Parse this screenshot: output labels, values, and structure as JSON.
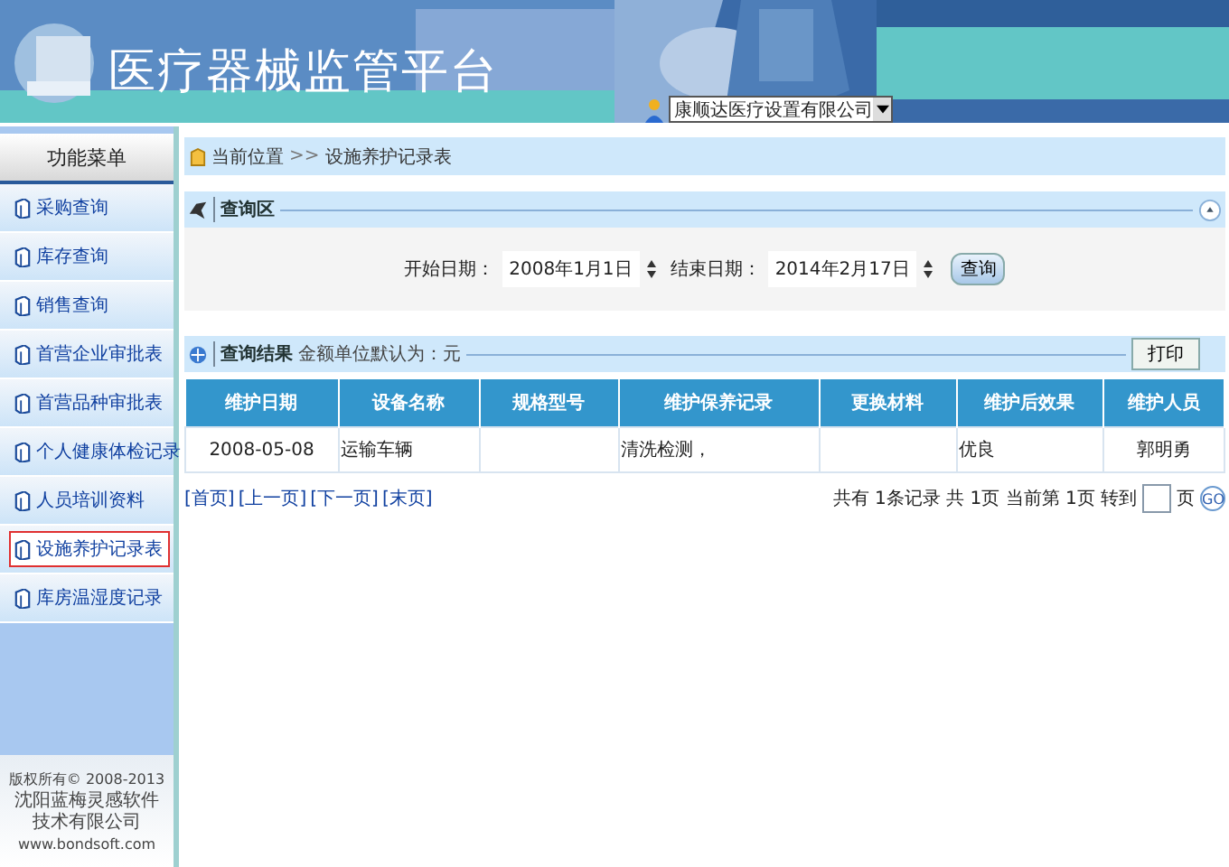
{
  "header": {
    "title": "医疗器械监管平台",
    "company_select": {
      "value": "康顺达医疗设置有限公司"
    }
  },
  "sidebar": {
    "title": "功能菜单",
    "items": [
      {
        "label": "采购查询",
        "selected": false
      },
      {
        "label": "库存查询",
        "selected": false
      },
      {
        "label": "销售查询",
        "selected": false
      },
      {
        "label": "首营企业审批表",
        "selected": false
      },
      {
        "label": "首营品种审批表",
        "selected": false
      },
      {
        "label": "个人健康体检记录",
        "selected": false
      },
      {
        "label": "人员培训资料",
        "selected": false
      },
      {
        "label": "设施养护记录表",
        "selected": true
      },
      {
        "label": "库房温湿度记录",
        "selected": false
      }
    ],
    "copyright": [
      "版权所有© 2008-2013",
      "沈阳蓝梅灵感软件技术有限公司",
      "www.bondsoft.com"
    ]
  },
  "breadcrumb": {
    "label": "当前位置",
    "separator": ">>",
    "current": "设施养护记录表"
  },
  "query": {
    "title": "查询区",
    "start_label": "开始日期：",
    "start_value": "2008年1月1日",
    "end_label": "结束日期：",
    "end_value": "2014年2月17日",
    "button": "查询"
  },
  "results": {
    "title": "查询结果",
    "note": "金额单位默认为：元",
    "print_button": "打印",
    "columns": [
      "维护日期",
      "设备名称",
      "规格型号",
      "维护保养记录",
      "更换材料",
      "维护后效果",
      "维护人员"
    ],
    "rows": [
      [
        "2008-05-08",
        "运输车辆",
        null,
        "清洗检测，",
        null,
        "优良",
        "郭明勇"
      ]
    ]
  },
  "pagination": {
    "links": [
      "[首页]",
      "[上一页]",
      "[下一页]",
      "[末页]"
    ],
    "summary": "共有 1条记录 共 1页 当前第 1页 转到",
    "page_unit": "页",
    "go_button": "GO"
  }
}
